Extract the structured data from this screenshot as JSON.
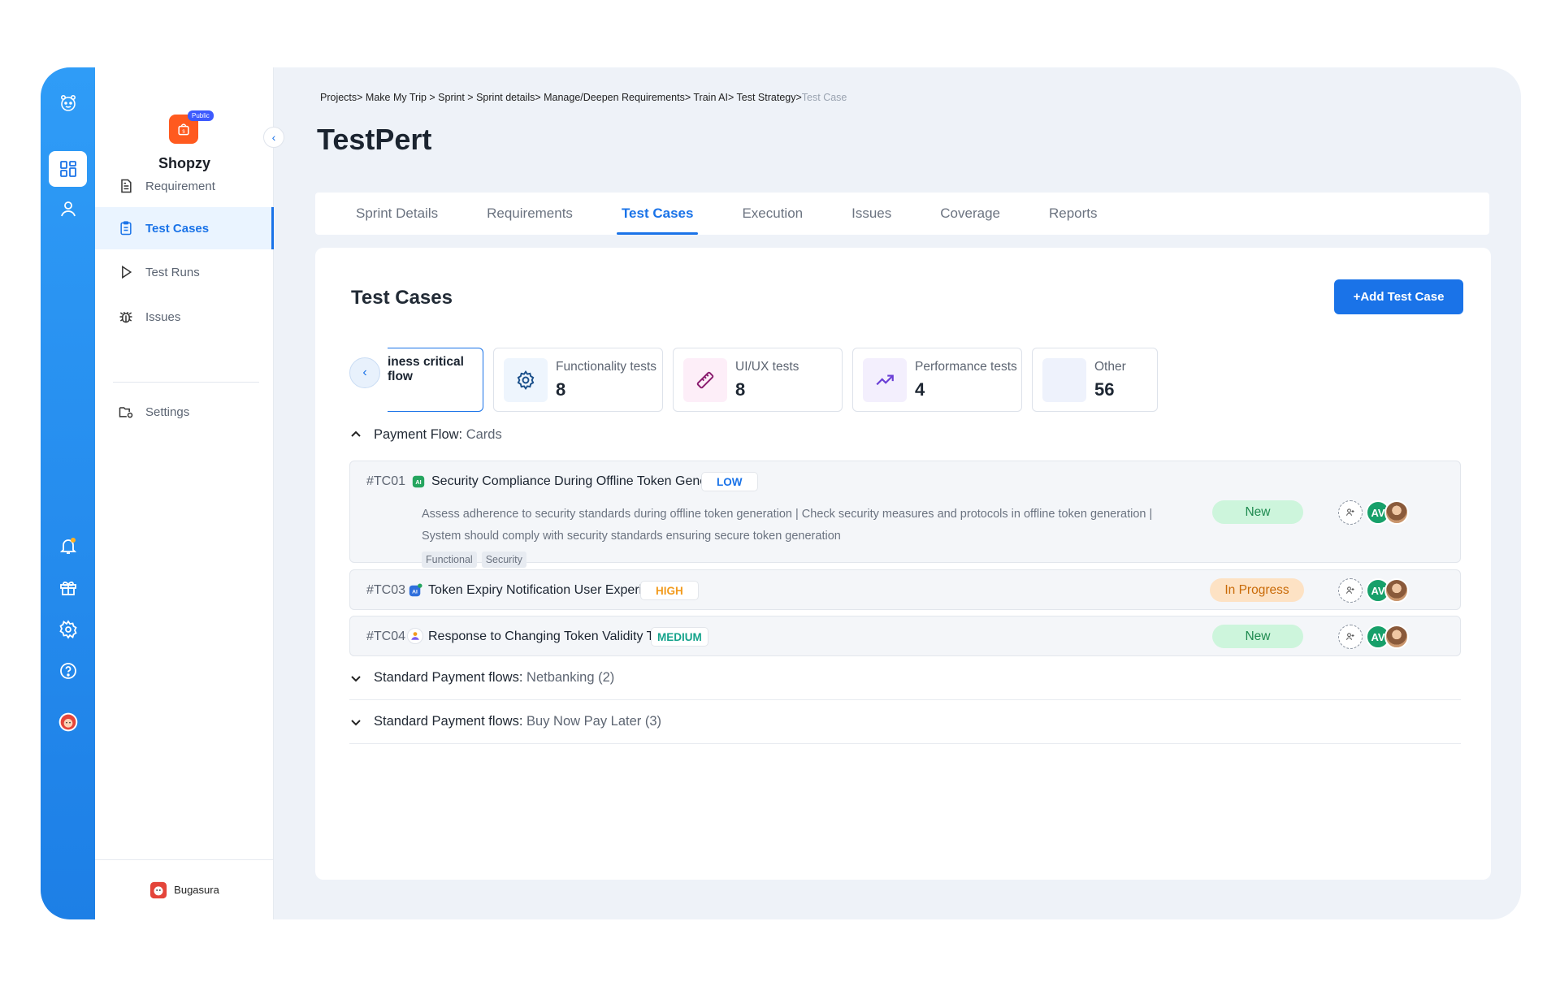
{
  "colors": {
    "primary": "#1a73e8",
    "rail": "#2f9cf7",
    "status_new": "#cdf5dc",
    "status_in_progress": "#fde2c4",
    "priority_low": "#1a73e8",
    "priority_high": "#f29b1d",
    "priority_medium": "#14a38b"
  },
  "rail": {
    "icons": [
      "tiger-logo-icon",
      "dashboard-icon",
      "user-icon",
      "bell-icon",
      "gift-icon",
      "settings-icon",
      "help-icon",
      "avatar-icon"
    ]
  },
  "sidebar": {
    "badge": "Public",
    "project_name": "Shopzy",
    "items": [
      {
        "label": "Requirement",
        "icon": "document-icon"
      },
      {
        "label": "Test Cases",
        "icon": "clipboard-icon"
      },
      {
        "label": "Test Runs",
        "icon": "play-icon"
      },
      {
        "label": "Issues",
        "icon": "bug-icon"
      },
      {
        "label": "Settings",
        "icon": "folder-gear-icon"
      }
    ],
    "footer": "Bugasura"
  },
  "breadcrumb": {
    "path": "Projects> Make My Trip >  Sprint > Sprint details> Manage/Deepen Requirements> Train AI> Test Strategy>",
    "current": "Test Case"
  },
  "page_title": "TestPert",
  "tabs": [
    "Sprint Details",
    "Requirements",
    "Test Cases",
    "Execution",
    "Issues",
    "Coverage",
    "Reports"
  ],
  "active_tab": "Test Cases",
  "main": {
    "title": "Test Cases",
    "add_button": "+Add Test Case",
    "stats": [
      {
        "label": "iness critical flow",
        "count": ""
      },
      {
        "label": "Functionality tests",
        "count": "8",
        "icon": "gear-icon"
      },
      {
        "label": "UI/UX tests",
        "count": "8",
        "icon": "ruler-icon"
      },
      {
        "label": "Performance tests",
        "count": "4",
        "icon": "trend-up-icon"
      },
      {
        "label": "Other",
        "count": "56"
      }
    ],
    "groups": [
      {
        "name": "Payment Flow:",
        "detail": "Cards",
        "expanded": true
      },
      {
        "name": "Standard Payment flows:",
        "detail": "Netbanking (2)",
        "expanded": false
      },
      {
        "name": "Standard Payment flows:",
        "detail": "Buy Now Pay Later (3)",
        "expanded": false
      }
    ],
    "test_cases": [
      {
        "id": "#TC01",
        "title": "Security Compliance During Offline Token Generation",
        "priority": "LOW",
        "description": "Assess adherence to security standards during offline token generation  |  Check security measures and protocols in offline token generation | System should comply with security standards ensuring secure token generation",
        "tags": [
          "Functional",
          "Security"
        ],
        "status": "New",
        "assignee": "AV"
      },
      {
        "id": "#TC03",
        "title": "Token Expiry Notification User Experience",
        "priority": "HIGH",
        "status": "In Progress",
        "assignee": "AV"
      },
      {
        "id": "#TC04",
        "title": "Response to Changing Token Validity Times",
        "priority": "MEDIUM",
        "status": "New",
        "assignee": "AV"
      }
    ]
  }
}
